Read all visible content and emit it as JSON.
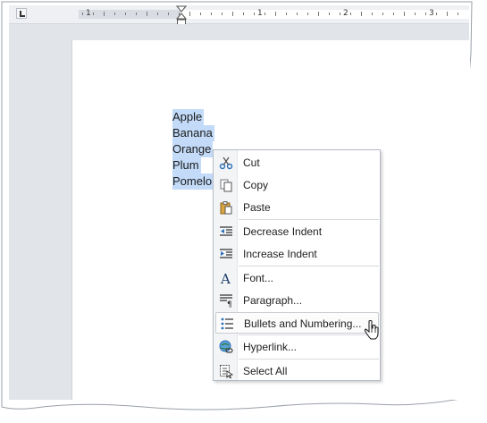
{
  "ruler": {
    "numbers": [
      "1",
      "1",
      "2",
      "3"
    ]
  },
  "document": {
    "lines": [
      "Apple",
      "Banana",
      "Orange",
      "Plum",
      "Pomelo"
    ]
  },
  "context_menu": {
    "items": [
      {
        "label": "Cut",
        "icon": "scissors-icon"
      },
      {
        "label": "Copy",
        "icon": "copy-icon"
      },
      {
        "label": "Paste",
        "icon": "paste-icon"
      },
      {
        "label": "Decrease Indent",
        "icon": "decrease-indent-icon"
      },
      {
        "label": "Increase Indent",
        "icon": "increase-indent-icon"
      },
      {
        "label": "Font...",
        "icon": "font-icon"
      },
      {
        "label": "Paragraph...",
        "icon": "paragraph-icon"
      },
      {
        "label": "Bullets and Numbering...",
        "icon": "bullets-icon",
        "hovered": true
      },
      {
        "label": "Hyperlink...",
        "icon": "hyperlink-icon"
      },
      {
        "label": "Select All",
        "icon": "select-all-icon"
      }
    ]
  },
  "colors": {
    "selection": "#c3dbf8",
    "canvas": "#e1e4e8",
    "menu_border": "#b6bcc5"
  }
}
